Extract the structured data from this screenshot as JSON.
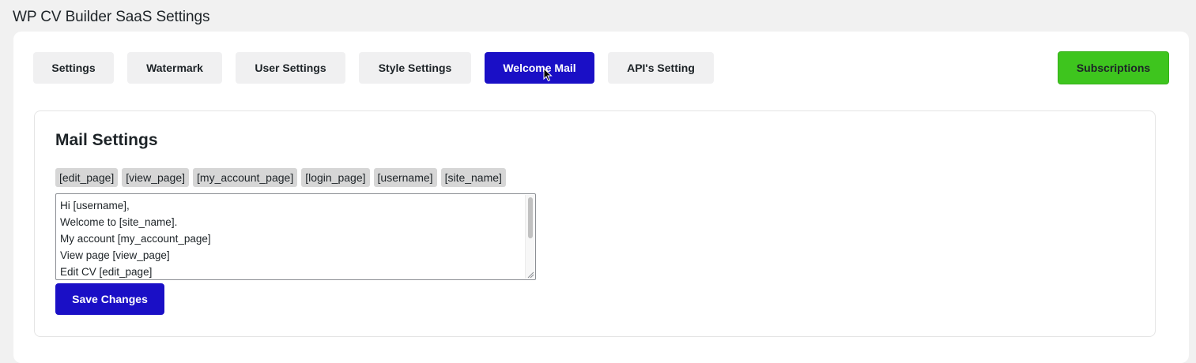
{
  "page": {
    "title": "WP CV Builder SaaS Settings"
  },
  "tabs": [
    {
      "label": "Settings",
      "active": false
    },
    {
      "label": "Watermark",
      "active": false
    },
    {
      "label": "User Settings",
      "active": false
    },
    {
      "label": "Style Settings",
      "active": false
    },
    {
      "label": "Welcome Mail",
      "active": true
    },
    {
      "label": "API's Setting",
      "active": false
    }
  ],
  "subscriptions": {
    "label": "Subscriptions"
  },
  "mail_settings": {
    "title": "Mail Settings",
    "shortcodes": [
      "[edit_page]",
      "[view_page]",
      "[my_account_page]",
      "[login_page]",
      "[username]",
      "[site_name]"
    ],
    "body": "Hi [username],\nWelcome to [site_name].\nMy account [my_account_page]\nView page [view_page]\nEdit CV [edit_page]",
    "save_label": "Save Changes"
  },
  "colors": {
    "primary": "#1a0fc6",
    "success": "#3ec51e",
    "tab_bg": "#f0f0f1",
    "page_bg": "#f1f1f1"
  }
}
